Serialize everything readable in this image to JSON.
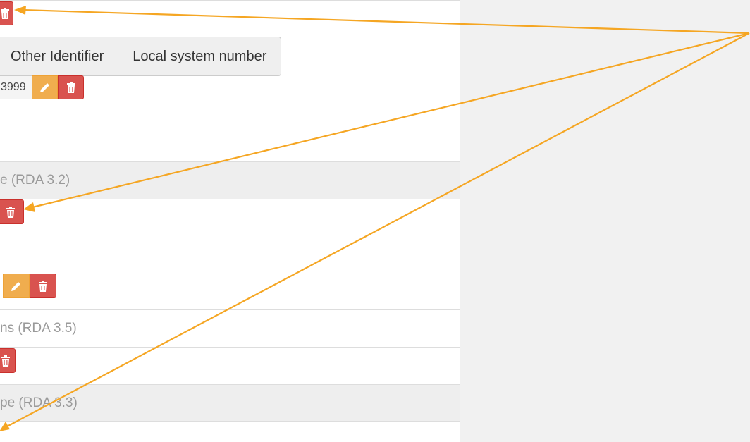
{
  "tabs": [
    {
      "label": "Other Identifier"
    },
    {
      "label": "Local system number"
    }
  ],
  "identifier_value": "3999",
  "sections": {
    "rda_3_2": "e (RDA 3.2)",
    "rda_3_5": "ns (RDA 3.5)",
    "rda_3_3": "pe (RDA 3.3)"
  },
  "icons": {
    "delete": "trash-icon",
    "edit": "pencil-icon"
  },
  "colors": {
    "delete": "#d9534f",
    "edit": "#f0ad4e",
    "annotation_arrow": "#f5a623"
  }
}
